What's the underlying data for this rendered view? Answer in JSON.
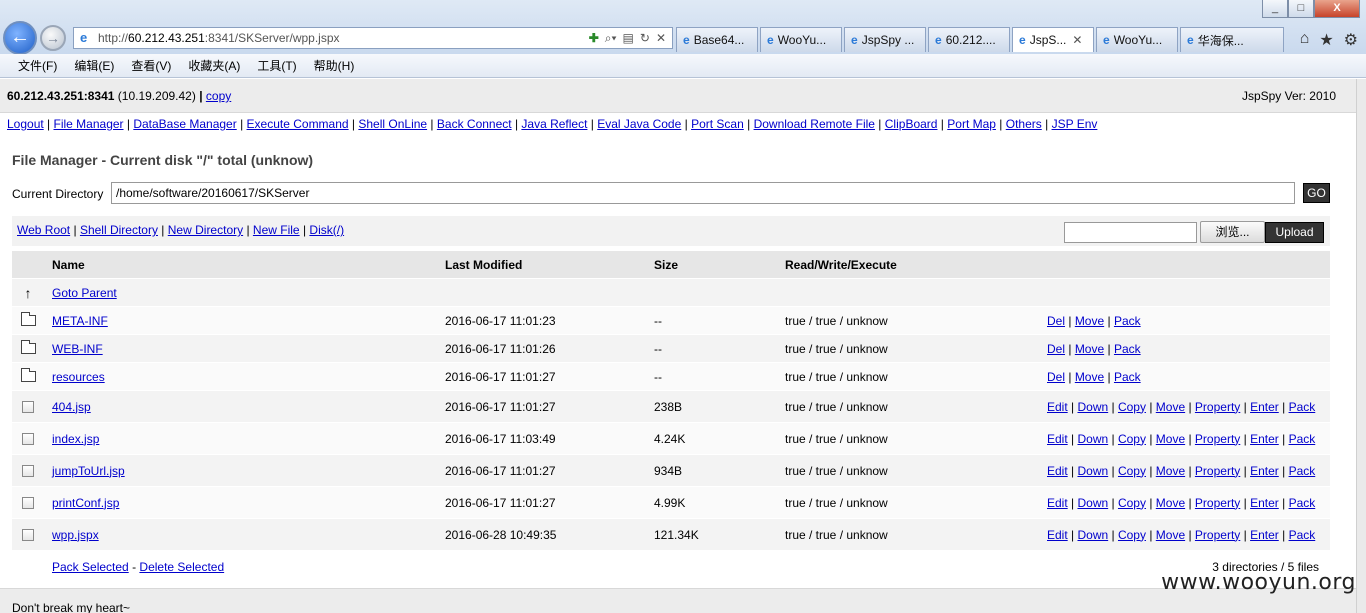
{
  "browser": {
    "window_controls": [
      "_",
      "□",
      "X"
    ],
    "address": {
      "url_prefix": "http://",
      "url_host": "60.212.43.251",
      "url_rest": ":8341/SKServer/wpp.jspx"
    },
    "tabs": [
      {
        "label": "Base64..."
      },
      {
        "label": "WooYu..."
      },
      {
        "label": "JspSpy ..."
      },
      {
        "label": "60.212...."
      },
      {
        "label": "JspS...",
        "active": true
      },
      {
        "label": "WooYu..."
      },
      {
        "label": "华海保..."
      }
    ],
    "menu": [
      "文件(F)",
      "编辑(E)",
      "查看(V)",
      "收藏夹(A)",
      "工具(T)",
      "帮助(H)"
    ]
  },
  "header": {
    "host": "60.212.43.251:8341",
    "ip": "(10.19.209.42)",
    "sep": "|",
    "copy": "copy",
    "version": "JspSpy Ver: 2010"
  },
  "topnav": [
    "Logout",
    "File Manager",
    "DataBase Manager",
    "Execute Command",
    "Shell OnLine",
    "Back Connect",
    "Java Reflect",
    "Eval Java Code",
    "Port Scan",
    "Download Remote File",
    "ClipBoard",
    "Port Map",
    "Others",
    "JSP Env"
  ],
  "file_manager": {
    "title": "File Manager - Current disk \"/\" total (unknow)",
    "current_dir_label": "Current Directory",
    "current_dir_value": "/home/software/20160617/SKServer",
    "go_label": "GO",
    "links": [
      "Web Root",
      "Shell Directory",
      "New Directory",
      "New File",
      "Disk(/)"
    ],
    "browse_label": "浏览...",
    "upload_label": "Upload",
    "columns": [
      "Name",
      "Last Modified",
      "Size",
      "Read/Write/Execute"
    ],
    "goto_parent": "Goto Parent",
    "dirs": [
      {
        "name": "META-INF",
        "modified": "2016-06-17 11:01:23",
        "size": "--",
        "rwx": "true / true / unknow",
        "ops": [
          "Del",
          "Move",
          "Pack"
        ]
      },
      {
        "name": "WEB-INF",
        "modified": "2016-06-17 11:01:26",
        "size": "--",
        "rwx": "true / true / unknow",
        "ops": [
          "Del",
          "Move",
          "Pack"
        ]
      },
      {
        "name": "resources",
        "modified": "2016-06-17 11:01:27",
        "size": "--",
        "rwx": "true / true / unknow",
        "ops": [
          "Del",
          "Move",
          "Pack"
        ]
      }
    ],
    "files": [
      {
        "name": "404.jsp",
        "modified": "2016-06-17 11:01:27",
        "size": "238B",
        "rwx": "true / true / unknow",
        "ops": [
          "Edit",
          "Down",
          "Copy",
          "Move",
          "Property",
          "Enter",
          "Pack"
        ]
      },
      {
        "name": "index.jsp",
        "modified": "2016-06-17 11:03:49",
        "size": "4.24K",
        "rwx": "true / true / unknow",
        "ops": [
          "Edit",
          "Down",
          "Copy",
          "Move",
          "Property",
          "Enter",
          "Pack"
        ]
      },
      {
        "name": "jumpToUrl.jsp",
        "modified": "2016-06-17 11:01:27",
        "size": "934B",
        "rwx": "true / true / unknow",
        "ops": [
          "Edit",
          "Down",
          "Copy",
          "Move",
          "Property",
          "Enter",
          "Pack"
        ]
      },
      {
        "name": "printConf.jsp",
        "modified": "2016-06-17 11:01:27",
        "size": "4.99K",
        "rwx": "true / true / unknow",
        "ops": [
          "Edit",
          "Down",
          "Copy",
          "Move",
          "Property",
          "Enter",
          "Pack"
        ]
      },
      {
        "name": "wpp.jspx",
        "modified": "2016-06-28 10:49:35",
        "size": "121.34K",
        "rwx": "true / true / unknow",
        "ops": [
          "Edit",
          "Down",
          "Copy",
          "Move",
          "Property",
          "Enter",
          "Pack"
        ]
      }
    ],
    "pack_selected": "Pack Selected",
    "delete_selected": "Delete Selected",
    "dash": "-",
    "summary": "3 directories / 5 files"
  },
  "footer_text": "Don't break my heart~",
  "watermark": "www.wooyun.org"
}
